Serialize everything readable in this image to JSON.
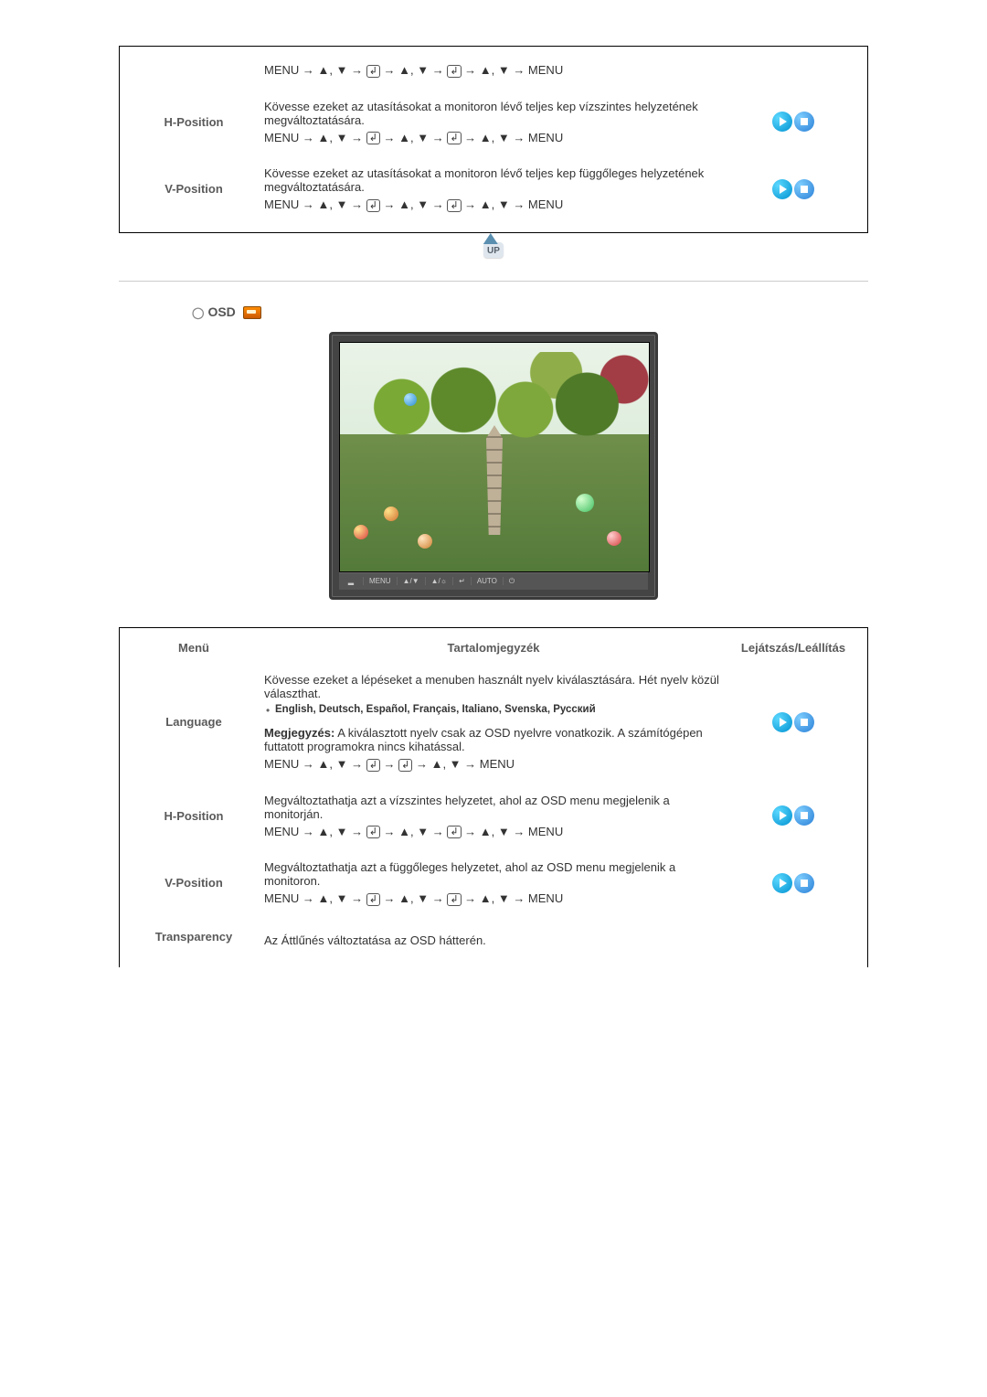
{
  "table1": {
    "row0": {
      "seq": "MENU → ▲, ▼ → ↵ → ▲, ▼ → ↵ → ▲, ▼ → MENU"
    },
    "hpos": {
      "label": "H-Position",
      "desc": "Kövesse ezeket az utasításokat a monitoron lévő teljes kep vízszintes helyzetének megváltoztatására.",
      "seq": "MENU → ▲, ▼ → ↵ → ▲, ▼ → ↵ → ▲, ▼ → MENU"
    },
    "vpos": {
      "label": "V-Position",
      "desc": "Kövesse ezeket az utasításokat a monitoron lévő teljes kep függőleges helyzetének megváltoztatására.",
      "seq": "MENU → ▲, ▼ → ↵ → ▲, ▼ → ↵ → ▲, ▼ → MENU"
    }
  },
  "up_label": "UP",
  "section_osd": "OSD",
  "monitor_buttons": {
    "b1": "MENU",
    "b2": "▲/▼",
    "b3": "▲/☼",
    "b4": "↵",
    "b5": "AUTO",
    "b6": "⏻"
  },
  "table2": {
    "headers": {
      "menu": "Menü",
      "content": "Tartalomjegyzék",
      "play": "Lejátszás/Leállítás"
    },
    "language": {
      "label": "Language",
      "desc1": "Kövesse ezeket a lépéseket a menuben használt nyelv kiválasztására. Hét nyelv közül választhat.",
      "lang_list": "English, Deutsch, Español, Français, Italiano, Svenska, Русский",
      "note_label": "Megjegyzés:",
      "note_text": " A kiválasztott nyelv csak az OSD nyelvre vonatkozik. A számítógépen futtatott programokra nincs kihatással.",
      "seq": "MENU → ▲, ▼ → ↵ → ↵ → ▲, ▼ → MENU"
    },
    "hpos": {
      "label": "H-Position",
      "desc": "Megváltoztathatja azt a vízszintes helyzetet, ahol az OSD menu megjelenik a monitorján.",
      "seq": "MENU → ▲, ▼ → ↵ → ▲, ▼ → ↵ → ▲, ▼ → MENU"
    },
    "vpos": {
      "label": "V-Position",
      "desc": "Megváltoztathatja azt a függőleges helyzetet, ahol az OSD menu megjelenik a monitoron.",
      "seq": "MENU → ▲, ▼ → ↵ → ▲, ▼ → ↵ → ▲, ▼ → MENU"
    },
    "transparency": {
      "label": "Transparency",
      "desc": "Az Áttlűnés változtatása az OSD hátterén."
    }
  }
}
